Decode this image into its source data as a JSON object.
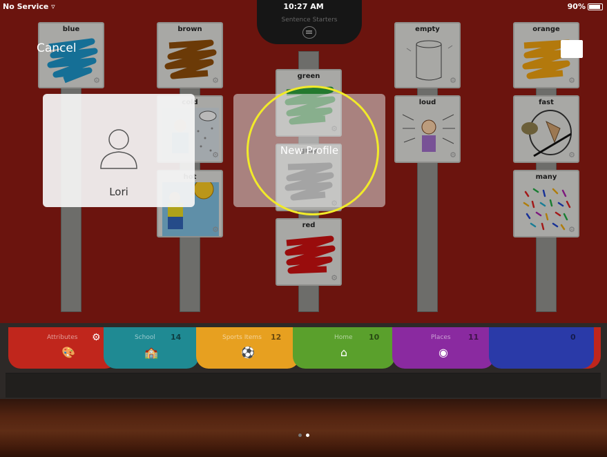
{
  "status_bar": {
    "carrier": "No Service",
    "time": "10:27 AM",
    "battery": "90%"
  },
  "notch": {
    "label": "Sentence Starters",
    "icon": "speech-bubble-icon"
  },
  "overlay": {
    "cancel_label": "Cancel",
    "profiles": [
      {
        "name": "Lori",
        "icon": "person-icon"
      },
      {
        "name": "New Profile"
      }
    ]
  },
  "cards": {
    "blue": "blue",
    "brown": "brown",
    "green": "green",
    "empty": "empty",
    "orange": "orange",
    "cold": "cold",
    "loud": "loud",
    "fast": "fast",
    "hot": "hot",
    "gray": "gray",
    "many": "many",
    "red": "red"
  },
  "colors": {
    "blue": "#1b8fc1",
    "brown": "#8a4b0a",
    "green": "#2e9c3c",
    "orange": "#e69c10",
    "gray": "#7a7a7a",
    "red": "#c41010",
    "highlight": "#f1ea2a"
  },
  "tabs": [
    {
      "name": "Attributes",
      "count": "",
      "icon": "palette-icon",
      "color": "#c0261c"
    },
    {
      "name": "School",
      "count": "14",
      "icon": "school-icon",
      "color": "#1f8a93"
    },
    {
      "name": "Sports Items",
      "count": "12",
      "icon": "soccer-ball-icon",
      "color": "#e7a020"
    },
    {
      "name": "Home",
      "count": "10",
      "icon": "house-icon",
      "color": "#5aa02c"
    },
    {
      "name": "Places",
      "count": "11",
      "icon": "map-pin-icon",
      "color": "#8a2aa0"
    },
    {
      "name": "",
      "count": "0",
      "icon": "",
      "color": "#2a3aa8"
    }
  ],
  "pager": {
    "pages": 2,
    "current": 2
  }
}
